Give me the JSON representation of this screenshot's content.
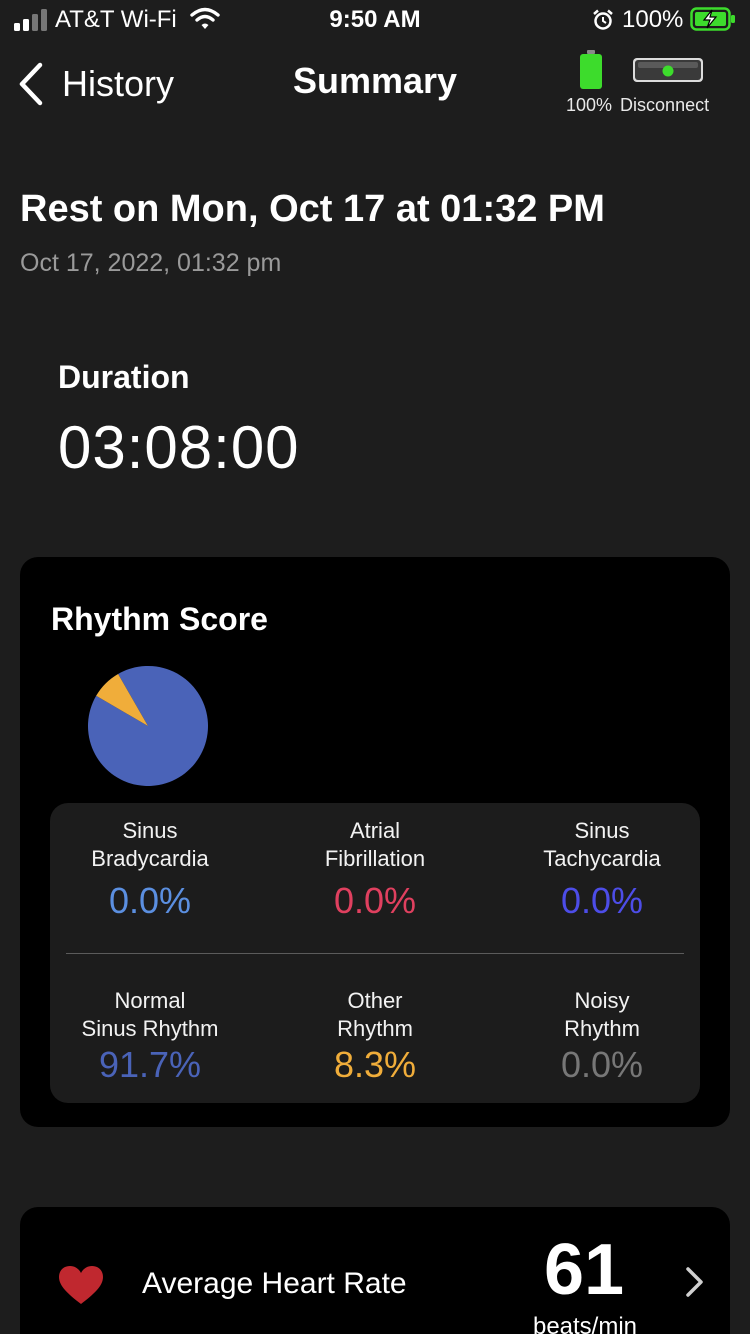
{
  "status_bar": {
    "carrier": "AT&T Wi-Fi",
    "time": "9:50 AM",
    "battery": "100%"
  },
  "nav": {
    "back_label": "History",
    "title": "Summary",
    "device_battery": "100%",
    "disconnect_label": "Disconnect"
  },
  "session": {
    "title": "Rest on Mon, Oct 17 at 01:32 PM",
    "date": "Oct 17, 2022, 01:32 pm"
  },
  "duration": {
    "label": "Duration",
    "value": "03:08:00"
  },
  "rhythm": {
    "title": "Rhythm Score",
    "stats": [
      {
        "label_line1": "Sinus",
        "label_line2": "Bradycardia",
        "value": "0.0%",
        "color": "#5b8fe0"
      },
      {
        "label_line1": "Atrial",
        "label_line2": "Fibrillation",
        "value": "0.0%",
        "color": "#e0405f"
      },
      {
        "label_line1": "Sinus",
        "label_line2": "Tachycardia",
        "value": "0.0%",
        "color": "#4d4de8"
      },
      {
        "label_line1": "Normal",
        "label_line2": "Sinus Rhythm",
        "value": "91.7%",
        "color": "#4a63b8"
      },
      {
        "label_line1": "Other",
        "label_line2": "Rhythm",
        "value": "8.3%",
        "color": "#f0ad3a"
      },
      {
        "label_line1": "Noisy",
        "label_line2": "Rhythm",
        "value": "0.0%",
        "color": "#777777"
      }
    ]
  },
  "chart_data": {
    "type": "pie",
    "categories": [
      "Normal Sinus Rhythm",
      "Other Rhythm"
    ],
    "values": [
      91.7,
      8.3
    ],
    "colors": [
      "#4a63b8",
      "#f0ad3a"
    ]
  },
  "heart_rate": {
    "label": "Average Heart Rate",
    "value": "61",
    "unit": "beats/min"
  },
  "colors": {
    "background": "#1d1d1d",
    "card": "#000000",
    "heart": "#c0282f",
    "battery_green": "#3ddc2c"
  }
}
